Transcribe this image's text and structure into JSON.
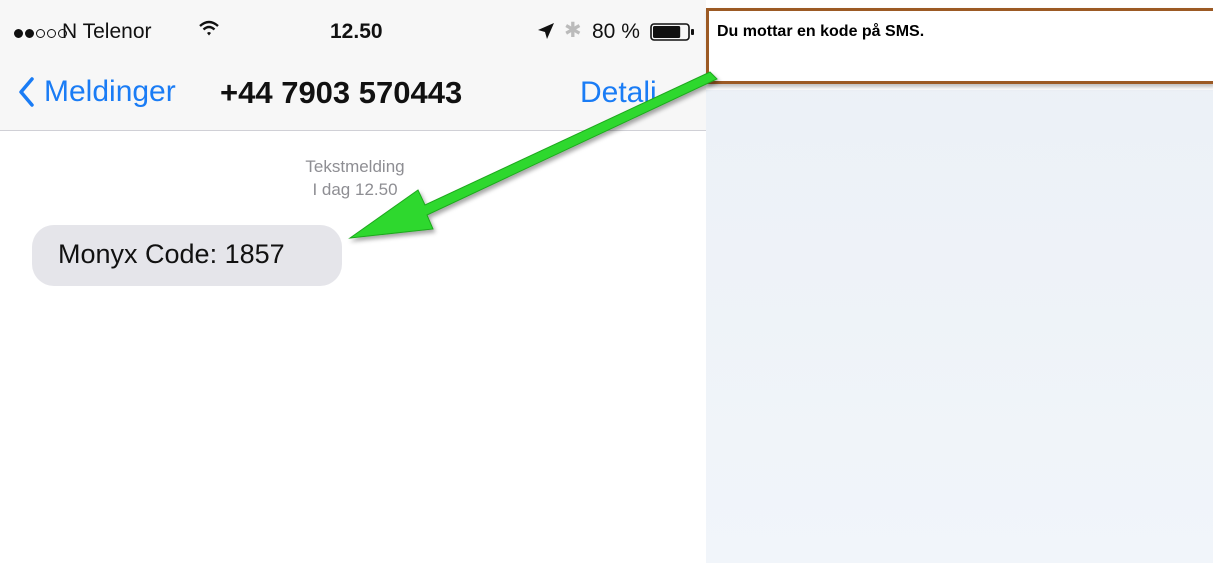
{
  "status_bar": {
    "carrier": "N Telenor",
    "signal_bars_filled": 2,
    "signal_bars_total": 5,
    "time": "12.50",
    "battery_percent": "80 %",
    "battery_level": 0.8,
    "icons": [
      "signal-dots-icon",
      "wifi-icon",
      "location-arrow-icon",
      "bluetooth-icon",
      "battery-icon"
    ]
  },
  "nav": {
    "back_label": "Meldinger",
    "title": "+44 7903 570443",
    "details_label": "Detalj"
  },
  "conversation": {
    "message_type": "Tekstmelding",
    "timestamp": "I dag 12.50",
    "messages": [
      {
        "text": "Monyx Code: 1857",
        "direction": "incoming"
      }
    ]
  },
  "annotation": {
    "callout_text": "Du mottar en kode på SMS.",
    "arrow_color": "#2fd82f",
    "callout_border_color": "#9c5a24"
  },
  "colors": {
    "ios_blue": "#1a7cf5",
    "bubble_gray": "#e5e5ea",
    "meta_gray": "#8e8e93"
  }
}
